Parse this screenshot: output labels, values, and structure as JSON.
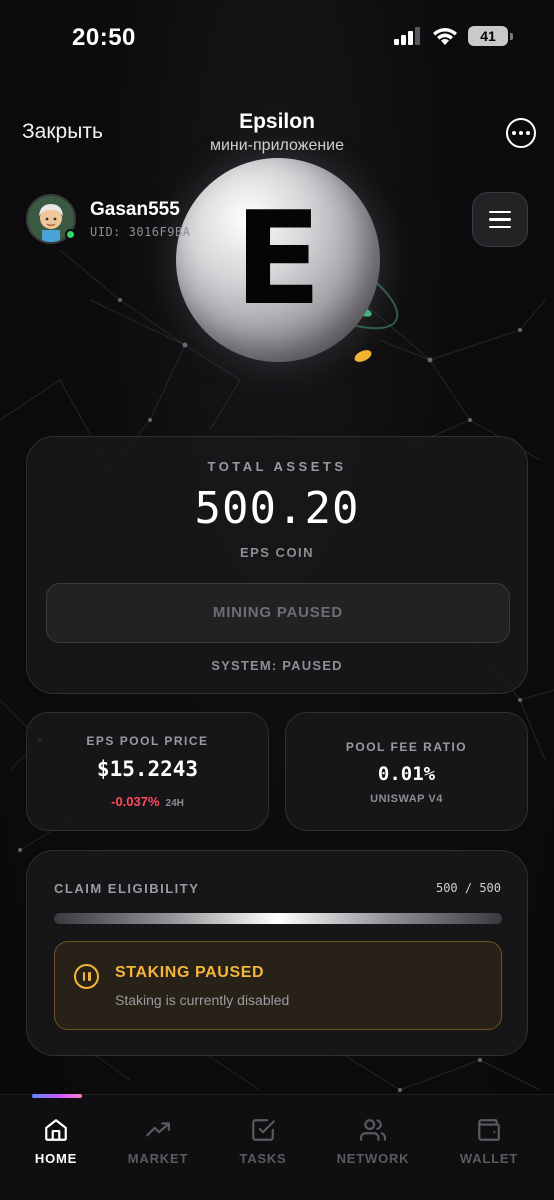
{
  "status_bar": {
    "time": "20:50",
    "battery": "41",
    "icons": [
      "signal-icon",
      "wifi-icon",
      "battery-icon"
    ]
  },
  "telegram_header": {
    "close_label": "Закрыть",
    "title": "Epsilon",
    "subtitle": "мини-приложение",
    "more_icon": "more-icon"
  },
  "logo": {
    "letter": "E"
  },
  "profile": {
    "username": "Gasan555",
    "uid": "UID: 3016F9BA",
    "online": true
  },
  "total_assets": {
    "label": "TOTAL ASSETS",
    "value": "500.20",
    "unit": "EPS COIN",
    "mining_button": "MINING PAUSED",
    "system_status": "SYSTEM: PAUSED"
  },
  "pool_price": {
    "label": "EPS POOL PRICE",
    "value": "$15.2243",
    "change": "-0.037%",
    "period": "24H"
  },
  "pool_fee": {
    "label": "POOL FEE RATIO",
    "value": "0.01%",
    "source": "UNISWAP V4"
  },
  "claim": {
    "label": "CLAIM ELIGIBILITY",
    "count": "500 / 500",
    "progress": 1.0,
    "staking_title": "STAKING PAUSED",
    "staking_desc": "Staking is currently disabled"
  },
  "nav": {
    "items": [
      {
        "label": "HOME",
        "icon": "home-icon",
        "active": true
      },
      {
        "label": "MARKET",
        "icon": "trending-up-icon",
        "active": false
      },
      {
        "label": "TASKS",
        "icon": "check-square-icon",
        "active": false
      },
      {
        "label": "NETWORK",
        "icon": "users-icon",
        "active": false
      },
      {
        "label": "WALLET",
        "icon": "wallet-icon",
        "active": false
      }
    ]
  },
  "colors": {
    "background": "#0b0b0c",
    "card": "#18181b",
    "negative": "#ff4a5e",
    "warning": "#f4b63a",
    "online": "#35d36b"
  }
}
